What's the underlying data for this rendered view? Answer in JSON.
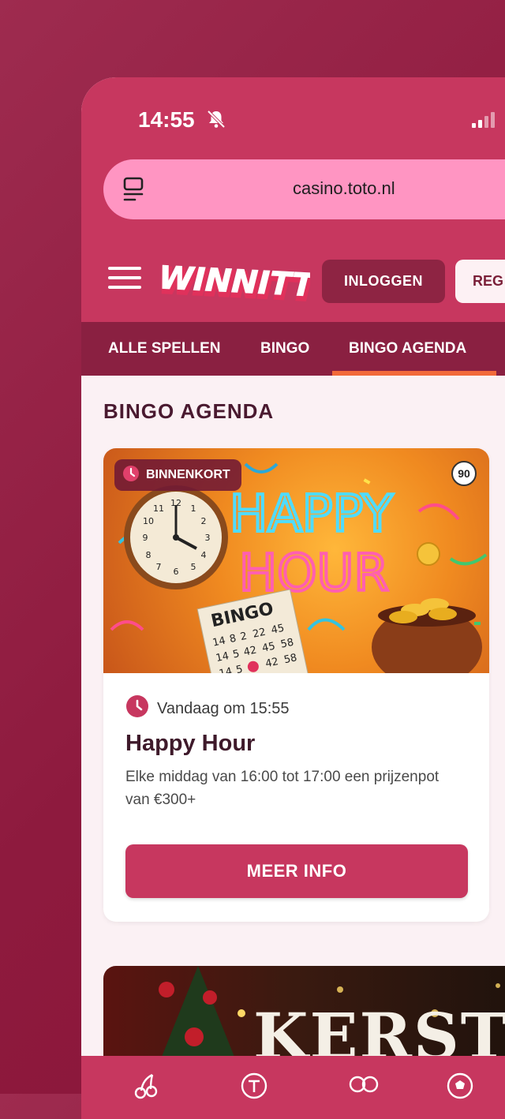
{
  "status": {
    "time": "14:55"
  },
  "browser": {
    "url": "casino.toto.nl"
  },
  "header": {
    "logo_text": "WINNITT",
    "login_label": "INLOGGEN",
    "register_label": "REG"
  },
  "nav": {
    "items": [
      {
        "label": "ALLE SPELLEN"
      },
      {
        "label": "BINGO"
      },
      {
        "label": "BINGO AGENDA",
        "active": true
      }
    ],
    "active_color": "#f26a3a"
  },
  "section": {
    "title": "BINGO AGENDA"
  },
  "events": [
    {
      "badge": "BINNENKORT",
      "age": "90",
      "image_title": [
        "HAPPY",
        "HOUR"
      ],
      "ticket_title": "BINGO",
      "ticket_numbers": [
        "14",
        "8",
        "2",
        "22",
        "45",
        "14",
        "5",
        "42",
        "45",
        "58",
        "14",
        "5",
        "42",
        "58"
      ],
      "date": "Vandaag om 15:55",
      "title": "Happy Hour",
      "description": "Elke middag van 16:00 tot 17:00 een prijzenpot van €300+",
      "button": "MEER INFO"
    },
    {
      "image_title": "KERST"
    }
  ],
  "icons": {
    "status": [
      "bell-slash-icon",
      "signal-icon"
    ],
    "browser": [
      "tab-list-icon"
    ],
    "header": [
      "menu-icon"
    ],
    "card": [
      "clock-icon"
    ],
    "bottom_bar": [
      "cherries-icon",
      "toto-icon",
      "bingo-balls-icon",
      "soccer-ball-icon"
    ]
  },
  "colors": {
    "brand": "#c7375f",
    "nav_bg": "#8a2041",
    "url_bar": "#ff95c2",
    "title_text": "#4a1a30"
  }
}
